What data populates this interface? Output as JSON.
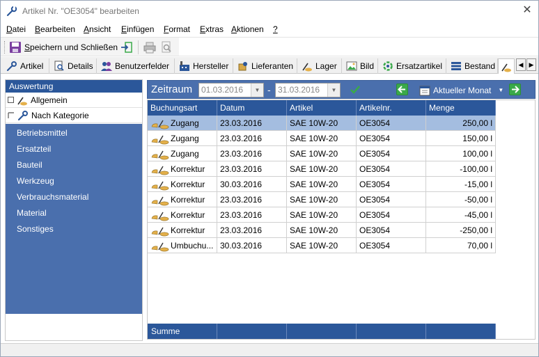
{
  "window": {
    "title": "Artikel Nr. \"OE3054\" bearbeiten",
    "close_glyph": "✕",
    "icon": "wrench-icon"
  },
  "menu": [
    {
      "accel": "D",
      "rest": "atei"
    },
    {
      "accel": "B",
      "rest": "earbeiten"
    },
    {
      "accel": "A",
      "rest": "nsicht"
    },
    {
      "accel": "E",
      "rest": "infügen"
    },
    {
      "accel": "F",
      "rest": "ormat"
    },
    {
      "accel": "E",
      "rest": "xtras"
    },
    {
      "accel": "A",
      "rest": "ktionen"
    },
    {
      "accel": "?",
      "rest": ""
    }
  ],
  "toolbar": {
    "save_label_accel": "S",
    "save_label_rest": "peichern und Schließen"
  },
  "tabs": [
    {
      "label": "Artikel",
      "icon": "wrench-icon"
    },
    {
      "label": "Details",
      "icon": "magnifier-document-icon"
    },
    {
      "label": "Benutzerfelder",
      "icon": "users-icon"
    },
    {
      "label": "Hersteller",
      "icon": "factory-icon"
    },
    {
      "label": "Lieferanten",
      "icon": "supplier-icon"
    },
    {
      "label": "Lager",
      "icon": "warehouse-icon"
    },
    {
      "label": "Bild",
      "icon": "image-icon"
    },
    {
      "label": "Ersatzartikel",
      "icon": "replace-icon"
    },
    {
      "label": "Bestand",
      "icon": "stock-icon"
    }
  ],
  "left_panel": {
    "header": "Auswertung",
    "rows": [
      {
        "label": "Allgemein"
      },
      {
        "label": "Nach Kategorie"
      }
    ],
    "categories": [
      "Betriebsmittel",
      "Ersatzteil",
      "Bauteil",
      "Werkzeug",
      "Verbrauchsmaterial",
      "Material",
      "Sonstiges"
    ]
  },
  "filter": {
    "label": "Zeitraum",
    "from": "01.03.2016",
    "to": "31.03.2016",
    "dash": "-",
    "period": "Aktueller Monat",
    "dropdown_glyph": "▼",
    "caret_glyph": "▼"
  },
  "grid": {
    "columns": [
      "Buchungsart",
      "Datum",
      "Artikel",
      "Artikelnr.",
      "Menge"
    ],
    "rows": [
      {
        "type": "Zugang",
        "date": "23.03.2016",
        "article": "SAE 10W-20",
        "number": "OE3054",
        "qty": "250,00 l",
        "selected": true
      },
      {
        "type": "Zugang",
        "date": "23.03.2016",
        "article": "SAE 10W-20",
        "number": "OE3054",
        "qty": "150,00 l"
      },
      {
        "type": "Zugang",
        "date": "23.03.2016",
        "article": "SAE 10W-20",
        "number": "OE3054",
        "qty": "100,00 l"
      },
      {
        "type": "Korrektur",
        "date": "23.03.2016",
        "article": "SAE 10W-20",
        "number": "OE3054",
        "qty": "-100,00 l"
      },
      {
        "type": "Korrektur",
        "date": "30.03.2016",
        "article": "SAE 10W-20",
        "number": "OE3054",
        "qty": "-15,00 l"
      },
      {
        "type": "Korrektur",
        "date": "23.03.2016",
        "article": "SAE 10W-20",
        "number": "OE3054",
        "qty": "-50,00 l"
      },
      {
        "type": "Korrektur",
        "date": "23.03.2016",
        "article": "SAE 10W-20",
        "number": "OE3054",
        "qty": "-45,00 l"
      },
      {
        "type": "Korrektur",
        "date": "23.03.2016",
        "article": "SAE 10W-20",
        "number": "OE3054",
        "qty": "-250,00 l"
      },
      {
        "type": "Umbuchu...",
        "date": "30.03.2016",
        "article": "SAE 10W-20",
        "number": "OE3054",
        "qty": "70,00 l"
      }
    ],
    "sum_label": "Summe"
  },
  "colors": {
    "header_blue": "#2b579a",
    "panel_blue": "#4a6fad",
    "selected_row": "#a4bde0",
    "green": "#3aa94a"
  }
}
